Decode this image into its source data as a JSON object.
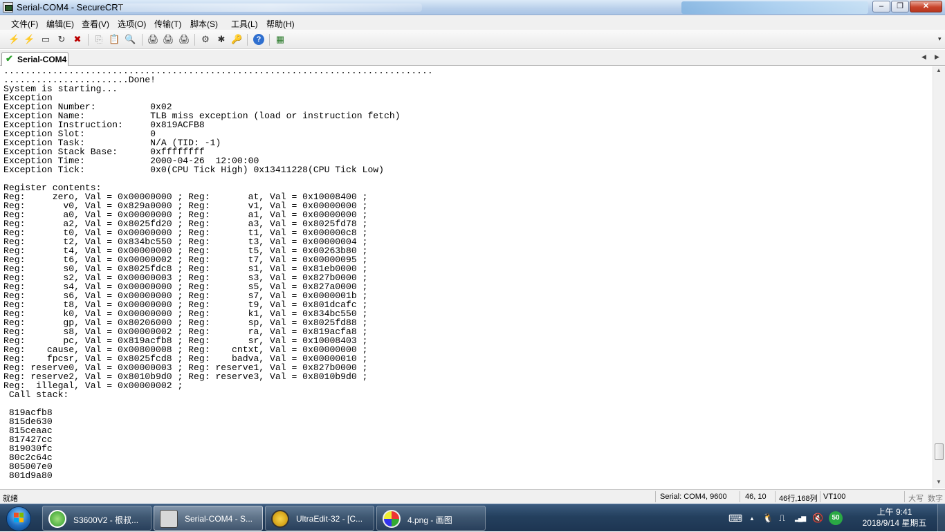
{
  "window": {
    "title": "Serial-COM4 - SecureCRT",
    "controls": {
      "minimize": "–",
      "maximize": "❐",
      "close": "✕"
    }
  },
  "menu": [
    "文件(F)",
    "编辑(E)",
    "查看(V)",
    "选项(O)",
    "传输(T)",
    "脚本(S)",
    "工具(L)",
    "帮助(H)"
  ],
  "toolbar": {
    "icons": [
      "connect-icon",
      "quick-connect-icon",
      "connect-tab-icon",
      "reconnect-icon",
      "disconnect-icon",
      "copy-icon",
      "paste-icon",
      "find-icon",
      "print-icon",
      "print-selection-icon",
      "print-setup-icon",
      "session-options-icon",
      "global-options-icon",
      "keymap-icon",
      "help-icon",
      "sftp-icon"
    ],
    "glyphs": [
      "⚡",
      "⚡",
      "▭",
      "↻",
      "✖",
      "⎘",
      "📋",
      "🔍",
      "🖨",
      "🖨",
      "🖨",
      "⚙",
      "✱",
      "🔑",
      "?",
      "▦"
    ],
    "overflow": "▾"
  },
  "tabs": [
    {
      "label": "Serial-COM4",
      "status_icon": "✔"
    }
  ],
  "tab_nav": {
    "left": "◀",
    "right": "▶"
  },
  "terminal": {
    "lines": [
      "...............................................................................",
      ".......................Done!",
      "System is starting...",
      "Exception",
      "Exception Number:          0x02",
      "Exception Name:            TLB miss exception (load or instruction fetch)",
      "Exception Instruction:     0x819ACFB8",
      "Exception Slot:            0",
      "Exception Task:            N/A (TID: -1)",
      "Exception Stack Base:      0xffffffff",
      "Exception Time:            2000-04-26  12:00:00",
      "Exception Tick:            0x0(CPU Tick High) 0x13411228(CPU Tick Low)",
      "",
      "Register contents:",
      "Reg:     zero, Val = 0x00000000 ; Reg:       at, Val = 0x10008400 ;",
      "Reg:       v0, Val = 0x829a0000 ; Reg:       v1, Val = 0x00000000 ;",
      "Reg:       a0, Val = 0x00000000 ; Reg:       a1, Val = 0x00000000 ;",
      "Reg:       a2, Val = 0x8025fd20 ; Reg:       a3, Val = 0x8025fd78 ;",
      "Reg:       t0, Val = 0x00000000 ; Reg:       t1, Val = 0x000000c8 ;",
      "Reg:       t2, Val = 0x834bc550 ; Reg:       t3, Val = 0x00000004 ;",
      "Reg:       t4, Val = 0x00000000 ; Reg:       t5, Val = 0x00263b80 ;",
      "Reg:       t6, Val = 0x00000002 ; Reg:       t7, Val = 0x00000095 ;",
      "Reg:       s0, Val = 0x8025fdc8 ; Reg:       s1, Val = 0x81eb0000 ;",
      "Reg:       s2, Val = 0x00000003 ; Reg:       s3, Val = 0x827b0000 ;",
      "Reg:       s4, Val = 0x00000000 ; Reg:       s5, Val = 0x827a0000 ;",
      "Reg:       s6, Val = 0x00000000 ; Reg:       s7, Val = 0x0000001b ;",
      "Reg:       t8, Val = 0x00000000 ; Reg:       t9, Val = 0x801dcafc ;",
      "Reg:       k0, Val = 0x00000000 ; Reg:       k1, Val = 0x834bc550 ;",
      "Reg:       gp, Val = 0x80206000 ; Reg:       sp, Val = 0x8025fd88 ;",
      "Reg:       s8, Val = 0x00000002 ; Reg:       ra, Val = 0x819acfa8 ;",
      "Reg:       pc, Val = 0x819acfb8 ; Reg:       sr, Val = 0x10008403 ;",
      "Reg:    cause, Val = 0x00800008 ; Reg:    cntxt, Val = 0x00000000 ;",
      "Reg:    fpcsr, Val = 0x8025fcd8 ; Reg:    badva, Val = 0x00000010 ;",
      "Reg: reserve0, Val = 0x00000003 ; Reg: reserve1, Val = 0x827b0000 ;",
      "Reg: reserve2, Val = 0x8010b9d0 ; Reg: reserve3, Val = 0x8010b9d0 ;",
      "Reg:  illegal, Val = 0x00000002 ;",
      " Call stack:",
      "",
      " 819acfb8",
      " 815de630",
      " 815ceaac",
      " 817427cc",
      " 819030fc",
      " 80c2c64c",
      " 805007e0",
      " 801d9a80"
    ]
  },
  "scrollbar": {
    "up": "▲",
    "down": "▼",
    "position": 0.95
  },
  "status": {
    "ready": "就绪",
    "connection": "Serial: COM4, 9600",
    "cursor": "46,  10",
    "size": "46行,168列",
    "emulation": "VT100",
    "caps": "大写",
    "num": "数字"
  },
  "taskbar": {
    "tasks": [
      {
        "label": "S3600V2 - 根叔...",
        "icon": "green-app-icon",
        "active": false
      },
      {
        "label": "Serial-COM4 - S...",
        "icon": "securecrt-icon",
        "active": true
      },
      {
        "label": "UltraEdit-32 - [C...",
        "icon": "ultraedit-icon",
        "active": false
      },
      {
        "label": "4.png - 画图",
        "icon": "paint-icon",
        "active": false
      }
    ],
    "tray": {
      "keyboard": "⌨",
      "arrow": "▲",
      "qq": "🐧",
      "usb": "⎍",
      "signal": "▂▄▆",
      "volume": "🔇",
      "badge": "50"
    },
    "clock": {
      "time": "上午 9:41",
      "date": "2018/9/14 星期五"
    }
  },
  "colors": {
    "accent": "#2a5d9e",
    "taskbar": "#24405e",
    "close": "#c9452c"
  }
}
